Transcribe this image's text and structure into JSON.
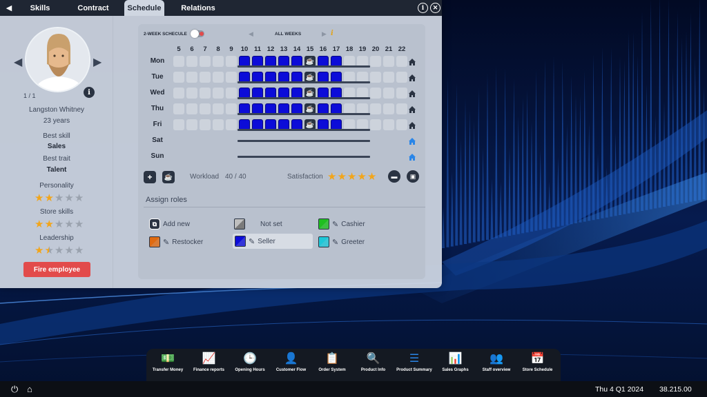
{
  "tabs": [
    {
      "label": "Skills",
      "active": false
    },
    {
      "label": "Contract",
      "active": false
    },
    {
      "label": "Schedule",
      "active": true
    },
    {
      "label": "Relations",
      "active": false
    }
  ],
  "header_icons": {
    "info": "info-icon",
    "close": "close-icon"
  },
  "employee": {
    "pager": "1 / 1",
    "name": "Langston Whitney",
    "age": "23 years",
    "best_skill_label": "Best skill",
    "best_skill": "Sales",
    "best_trait_label": "Best trait",
    "best_trait": "Talent",
    "personality_label": "Personality",
    "personality_stars": 2,
    "store_skills_label": "Store skills",
    "store_skills_stars": 2,
    "leadership_label": "Leadership",
    "leadership_stars": 1.5,
    "fire_button": "Fire employee"
  },
  "schedule": {
    "two_week_label": "2-WEEK SCHECULE",
    "two_week_enabled": false,
    "weeks_label": "ALL WEEKS",
    "hours": [
      "5",
      "6",
      "7",
      "8",
      "9",
      "10",
      "11",
      "12",
      "13",
      "14",
      "15",
      "16",
      "17",
      "18",
      "19",
      "20",
      "21",
      "22"
    ],
    "days": [
      {
        "label": "Mon",
        "seller_hours": [
          10,
          11,
          12,
          13,
          14,
          16,
          17
        ],
        "break_hours": [
          15
        ],
        "workday": true
      },
      {
        "label": "Tue",
        "seller_hours": [
          10,
          11,
          12,
          13,
          14,
          16,
          17
        ],
        "break_hours": [
          15
        ],
        "workday": true
      },
      {
        "label": "Wed",
        "seller_hours": [
          10,
          11,
          12,
          13,
          14,
          16,
          17
        ],
        "break_hours": [
          15
        ],
        "workday": true
      },
      {
        "label": "Thu",
        "seller_hours": [
          10,
          11,
          12,
          13,
          14,
          16,
          17
        ],
        "break_hours": [
          15
        ],
        "workday": true
      },
      {
        "label": "Fri",
        "seller_hours": [
          10,
          11,
          12,
          13,
          14,
          16,
          17
        ],
        "break_hours": [
          15
        ],
        "workday": true
      },
      {
        "label": "Sat",
        "seller_hours": [],
        "break_hours": [],
        "workday": false
      },
      {
        "label": "Sun",
        "seller_hours": [],
        "break_hours": [],
        "workday": false
      }
    ],
    "workload_label": "Workload",
    "workload_value": "40 / 40",
    "satisfaction_label": "Satisfaction",
    "satisfaction_stars": 5
  },
  "roles": {
    "title": "Assign roles",
    "items": [
      {
        "label": "Add new",
        "color": ""
      },
      {
        "label": "Not set",
        "color": "#8f8f8f"
      },
      {
        "label": "Cashier",
        "color": "#1fbf1f"
      },
      {
        "label": "Restocker",
        "color": "#e06a10"
      },
      {
        "label": "Seller",
        "color": "#0c0cd8"
      },
      {
        "label": "Greeter",
        "color": "#1fc8d8"
      }
    ],
    "selected": "Seller"
  },
  "toolbar": [
    {
      "label": "Transfer Money",
      "icon": "money-transfer-icon"
    },
    {
      "label": "Finance reports",
      "icon": "finance-report-icon"
    },
    {
      "label": "Opening Hours",
      "icon": "clock-icon"
    },
    {
      "label": "Customer Flow",
      "icon": "customer-flow-icon"
    },
    {
      "label": "Order System",
      "icon": "clipboard-icon"
    },
    {
      "label": "Product Info",
      "icon": "search-icon"
    },
    {
      "label": "Product Summary",
      "icon": "list-icon"
    },
    {
      "label": "Sales Graphs",
      "icon": "bar-chart-icon"
    },
    {
      "label": "Staff overview",
      "icon": "staff-icon"
    },
    {
      "label": "Store Schedule",
      "icon": "calendar-icon"
    }
  ],
  "status": {
    "date": "Thu 4 Q1 2024",
    "money": "38.215.00"
  }
}
